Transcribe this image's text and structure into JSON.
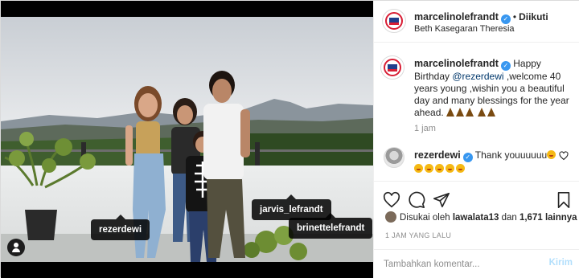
{
  "post": {
    "username": "marcelinolefrandt",
    "follow_status": "Diikuti",
    "location": "Beth Kasegaran Theresia",
    "caption_user": "marcelinolefrandt",
    "caption_mention": "@rezerdewi",
    "caption_before": "Happy Birthday ",
    "caption_after": " ,welcome 40 years young ,wishin you a beautiful day and many blessings for the year ahead.",
    "caption_time": "1 jam"
  },
  "photo": {
    "tags": [
      {
        "label": "rezerdewi"
      },
      {
        "label": "jarvis_lefrandt"
      },
      {
        "label": "brinettelefrandt"
      }
    ]
  },
  "comments": [
    {
      "user": "rezerdewi",
      "text": "Thank youuuuuu"
    }
  ],
  "likes": {
    "prefix": "Disukai oleh ",
    "user": "lawalata13",
    "middle": " dan ",
    "count": "1,671 lainnya"
  },
  "timestamp": "1 JAM YANG LALU",
  "comment_box": {
    "placeholder": "Tambahkan komentar...",
    "post_label": "Kirim"
  },
  "icons": {
    "like": "heart-icon",
    "comment": "comment-icon",
    "share": "share-icon",
    "save": "bookmark-icon",
    "verified": "verified-badge-icon"
  },
  "colors": {
    "verified": "#3897f0",
    "mention": "#00376b",
    "post_button_disabled": "#b2dffc"
  }
}
